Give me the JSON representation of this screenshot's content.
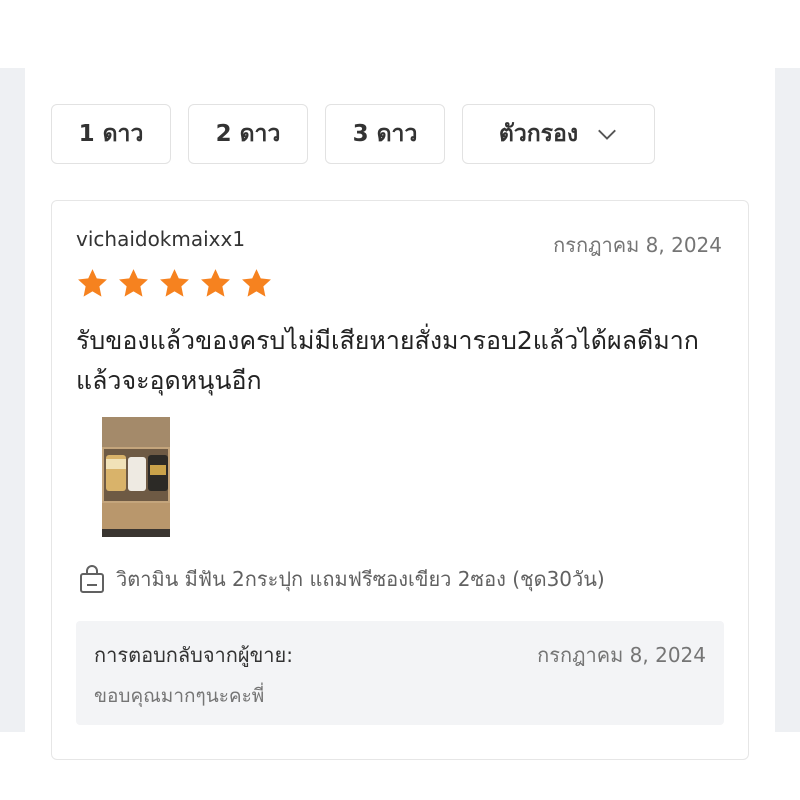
{
  "filters": [
    {
      "label": "1 ดาว"
    },
    {
      "label": "2 ดาว"
    },
    {
      "label": "3 ดาว"
    },
    {
      "label": "ตัวกรอง",
      "icon": "chevron-down-icon"
    }
  ],
  "review": {
    "username": "vichaidokmaixx1",
    "date": "กรกฎาคม 8, 2024",
    "rating": 5,
    "rating_max": 5,
    "star_color": "#f6821f",
    "text": "รับของแล้วของครบไม่มีเสียหายสั่งมารอบ2แล้วได้ผลดีมากแล้วจะอุดหนุนอีก",
    "photo_count": 1,
    "variant": {
      "icon": "shopping-bag-icon",
      "label": "วิตามิน มีฟัน 2กระปุก แถมฟรีซองเขียว 2ซอง (ชุด30วัน)"
    }
  },
  "seller_reply": {
    "title": "การตอบกลับจากผู้ขาย:",
    "date": "กรกฎาคม 8, 2024",
    "text": "ขอบคุณมากๆนะคะพี่"
  }
}
